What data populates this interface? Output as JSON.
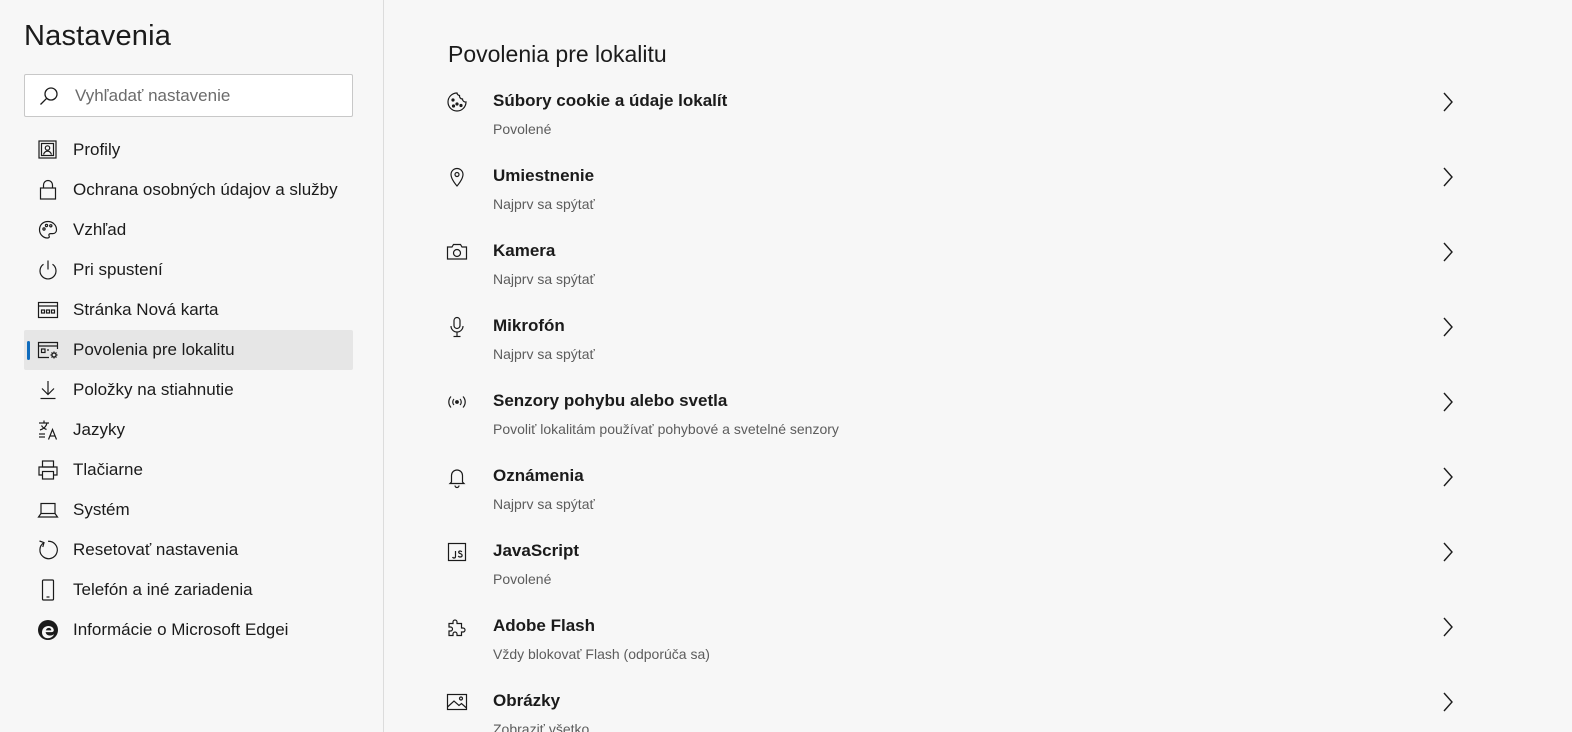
{
  "sidebar": {
    "title": "Nastavenia",
    "search": {
      "placeholder": "Vyhľadať nastavenie",
      "value": ""
    },
    "items": [
      {
        "label": "Profily",
        "icon": "profile-icon"
      },
      {
        "label": "Ochrana osobných údajov a služby",
        "icon": "lock-icon"
      },
      {
        "label": "Vzhľad",
        "icon": "palette-icon"
      },
      {
        "label": "Pri spustení",
        "icon": "power-icon"
      },
      {
        "label": "Stránka Nová karta",
        "icon": "new-tab-page-icon"
      },
      {
        "label": "Povolenia pre lokalitu",
        "icon": "site-permissions-icon",
        "active": true
      },
      {
        "label": "Položky na stiahnutie",
        "icon": "download-icon"
      },
      {
        "label": "Jazyky",
        "icon": "languages-icon"
      },
      {
        "label": "Tlačiarne",
        "icon": "printer-icon"
      },
      {
        "label": "Systém",
        "icon": "laptop-icon"
      },
      {
        "label": "Resetovať nastavenia",
        "icon": "reset-icon"
      },
      {
        "label": "Telefón a iné zariadenia",
        "icon": "phone-icon"
      },
      {
        "label": "Informácie o Microsoft Edgei",
        "icon": "edge-logo-icon"
      }
    ],
    "accent_color": "#0f6cbd"
  },
  "main": {
    "title": "Povolenia pre lokalitu",
    "permissions": [
      {
        "name": "Súbory cookie a údaje lokalít",
        "status": "Povolené",
        "icon": "cookie-icon"
      },
      {
        "name": "Umiestnenie",
        "status": "Najprv sa spýtať",
        "icon": "location-pin-icon"
      },
      {
        "name": "Kamera",
        "status": "Najprv sa spýtať",
        "icon": "camera-icon"
      },
      {
        "name": "Mikrofón",
        "status": "Najprv sa spýtať",
        "icon": "microphone-icon"
      },
      {
        "name": "Senzory pohybu alebo svetla",
        "status": "Povoliť lokalitám používať pohybové a svetelné senzory",
        "icon": "sensor-icon"
      },
      {
        "name": "Oznámenia",
        "status": "Najprv sa spýtať",
        "icon": "bell-icon"
      },
      {
        "name": "JavaScript",
        "status": "Povolené",
        "icon": "javascript-icon"
      },
      {
        "name": "Adobe Flash",
        "status": "Vždy blokovať Flash (odporúča sa)",
        "icon": "puzzle-icon"
      },
      {
        "name": "Obrázky",
        "status": "Zobraziť všetko",
        "icon": "image-icon"
      }
    ]
  }
}
